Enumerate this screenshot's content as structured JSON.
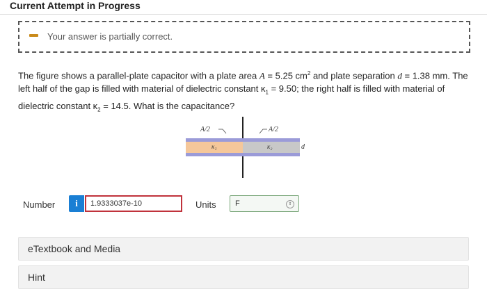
{
  "header": {
    "title": "Current Attempt in Progress"
  },
  "feedback": {
    "message": "Your answer is partially correct.",
    "accent_color": "#c98a1b",
    "icon": "minus-icon"
  },
  "question": {
    "line1_a": "The figure shows a parallel-plate capacitor with a plate area ",
    "var_A": "A",
    "line1_b": " = 5.25 cm",
    "sup2": "2",
    "line1_c": " and plate separation ",
    "var_d": "d",
    "line1_d": " = 1.38 mm. The left half of the gap is filled with material of dielectric constant κ",
    "sub1": "1",
    "line1_e": " = 9.50; the right half is filled with material of dielectric constant κ",
    "sub2": "2",
    "line1_f": " = 14.5. What is the capacitance?"
  },
  "figure": {
    "left_label": "A/2",
    "right_label": "A/2",
    "kappa1": "κ₁",
    "kappa2": "κ₂",
    "gap_label": "d",
    "colors": {
      "plate": "#9b9bd8",
      "left_fill": "#f5c79a",
      "right_fill": "#c8c8c8"
    }
  },
  "answer": {
    "number_label": "Number",
    "info_icon": "i",
    "value": "1.9333037e-10",
    "units_label": "Units",
    "units_value": "F"
  },
  "resources": {
    "etextbook": "eTextbook and Media",
    "hint": "Hint"
  }
}
